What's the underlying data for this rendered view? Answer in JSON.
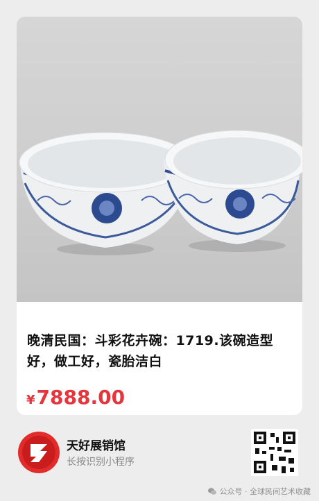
{
  "product": {
    "title": "晚清民国：斗彩花卉碗：1719.该碗造型好，做工好，瓷胎洁白",
    "currency_symbol": "¥",
    "price": "7888.00"
  },
  "shop": {
    "name": "天好展销馆",
    "hint": "长按识别小程序"
  },
  "watermark": {
    "text": "公众号 · 全球民间艺术收藏"
  },
  "colors": {
    "price": "#e5353d",
    "logo_red": "#e22b2b",
    "background": "#ededed"
  },
  "icons": [
    "bowl-photo",
    "shop-logo-icon",
    "qr-code-icon",
    "wechat-icon"
  ]
}
